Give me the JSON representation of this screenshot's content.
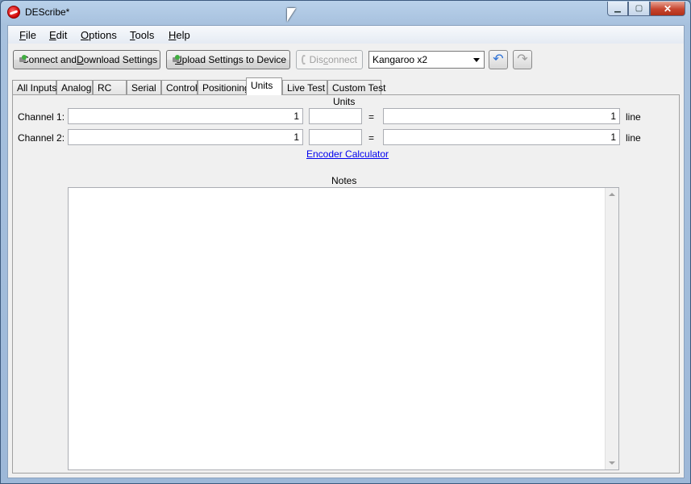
{
  "window": {
    "title": "DEScribe*"
  },
  "menu": {
    "items": [
      {
        "key": "F",
        "rest": "ile"
      },
      {
        "key": "E",
        "rest": "dit"
      },
      {
        "key": "O",
        "rest": "ptions"
      },
      {
        "key": "T",
        "rest": "ools"
      },
      {
        "key": "H",
        "rest": "elp"
      }
    ]
  },
  "toolbar": {
    "connect_pre": "Connect and ",
    "connect_key": "D",
    "connect_post": "ownload Settings",
    "upload_key": "U",
    "upload_post": "pload Settings to Device",
    "disconnect_pre": "Dis",
    "disconnect_key": "c",
    "disconnect_post": "onnect",
    "device": "Kangaroo x2",
    "undo_icon": "undo-icon",
    "redo_icon": "redo-icon"
  },
  "tabs": [
    "All Inputs",
    "Analog",
    "RC",
    "Serial",
    "Control",
    "Positioning",
    "Units",
    "Live Test",
    "Custom Test"
  ],
  "active_tab": "Units",
  "units": {
    "header": "Units",
    "channels": [
      {
        "label": "Channel 1:",
        "machine_value": "1",
        "unit_name": "",
        "equals": "=",
        "user_value": "1",
        "unit": "line"
      },
      {
        "label": "Channel 2:",
        "machine_value": "1",
        "unit_name": "",
        "equals": "=",
        "user_value": "1",
        "unit": "line"
      }
    ],
    "encoder_link": "Encoder Calculator",
    "notes_label": "Notes",
    "notes_text": ""
  }
}
